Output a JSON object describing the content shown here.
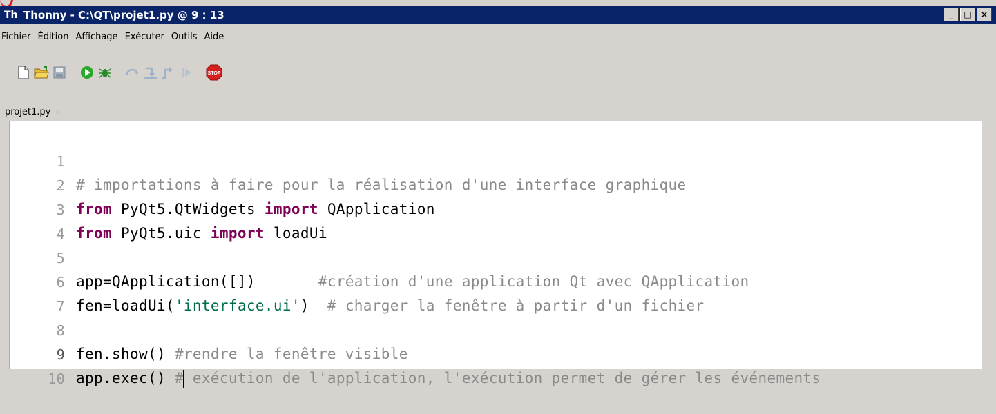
{
  "window": {
    "title": "Thonny  -  C:\\QT\\projet1.py  @  9 : 13",
    "icon_label": "Th",
    "buttons": [
      "_",
      "□",
      "×"
    ]
  },
  "menu": [
    "Fichier",
    "Édition",
    "Affichage",
    "Exécuter",
    "Outils",
    "Aide"
  ],
  "toolbar": {
    "icons": [
      "new-file-icon",
      "open-folder-icon",
      "save-icon",
      "run-icon",
      "debug-icon",
      "step-over-icon",
      "step-into-icon",
      "step-out-icon",
      "resume-icon",
      "stop-icon"
    ],
    "stop_label": "STOP"
  },
  "editor": {
    "tab_label": "projet1.py",
    "tab_close": "×",
    "lines": [
      {
        "n": "1",
        "text": "# importations à faire pour la réalisation d'une interface graphique"
      },
      {
        "n": "2",
        "text": "from PyQt5.QtWidgets import QApplication"
      },
      {
        "n": "3",
        "text": "from PyQt5.uic import loadUi"
      },
      {
        "n": "4",
        "text": ""
      },
      {
        "n": "5",
        "text": "app=QApplication([])       #création d'une application Qt avec QApplication"
      },
      {
        "n": "6",
        "text": "fen=loadUi('interface.ui')  # charger la fenêtre à partir d'un fichier"
      },
      {
        "n": "7",
        "text": ""
      },
      {
        "n": "8",
        "text": "fen.show() #rendre la fenêtre visible"
      },
      {
        "n": "9",
        "text": "app.exec() # exécution de l'application, l'exécution permet de gérer les événements"
      },
      {
        "n": "10",
        "text": ""
      }
    ],
    "cursor": {
      "line": 9,
      "column": 13
    }
  }
}
